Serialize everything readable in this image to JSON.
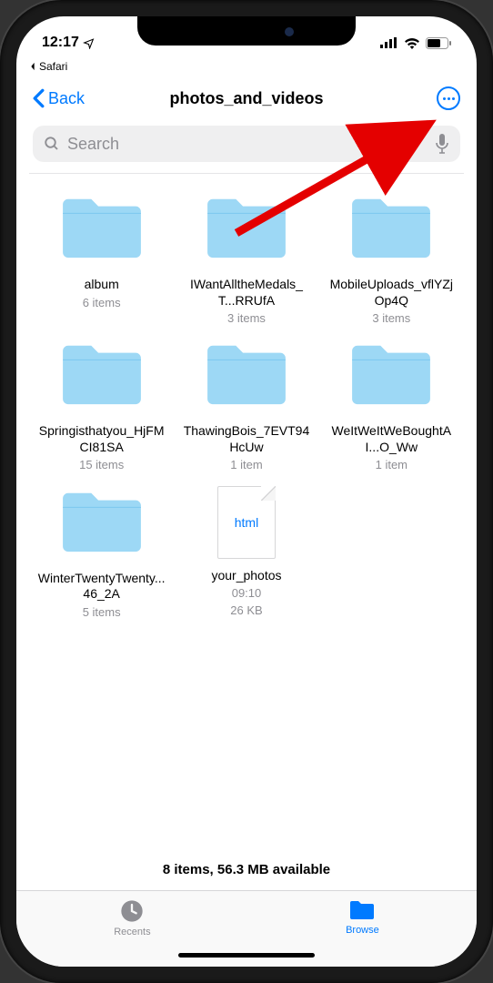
{
  "status": {
    "time": "12:17",
    "breadcrumb_app": "Safari"
  },
  "nav": {
    "back_label": "Back",
    "title": "photos_and_videos"
  },
  "search": {
    "placeholder": "Search"
  },
  "items": [
    {
      "type": "folder",
      "name": "album",
      "sub": "6 items"
    },
    {
      "type": "folder",
      "name": "IWantAlltheMedals_T...RRUfA",
      "sub": "3 items"
    },
    {
      "type": "folder",
      "name": "MobileUploads_vflYZjOp4Q",
      "sub": "3 items"
    },
    {
      "type": "folder",
      "name": "Springisthatyou_HjFMCI81SA",
      "sub": "15 items"
    },
    {
      "type": "folder",
      "name": "ThawingBois_7EVT94HcUw",
      "sub": "1 item"
    },
    {
      "type": "folder",
      "name": "WeItWeItWeBoughtAI...O_Ww",
      "sub": "1 item"
    },
    {
      "type": "folder",
      "name": "WinterTwentyTwenty...46_2A",
      "sub": "5 items"
    },
    {
      "type": "file",
      "name": "your_photos",
      "ext": "html",
      "time": "09:10",
      "size": "26 KB"
    }
  ],
  "footer": {
    "summary": "8 items, 56.3 MB available"
  },
  "tabs": {
    "recents": "Recents",
    "browse": "Browse"
  }
}
